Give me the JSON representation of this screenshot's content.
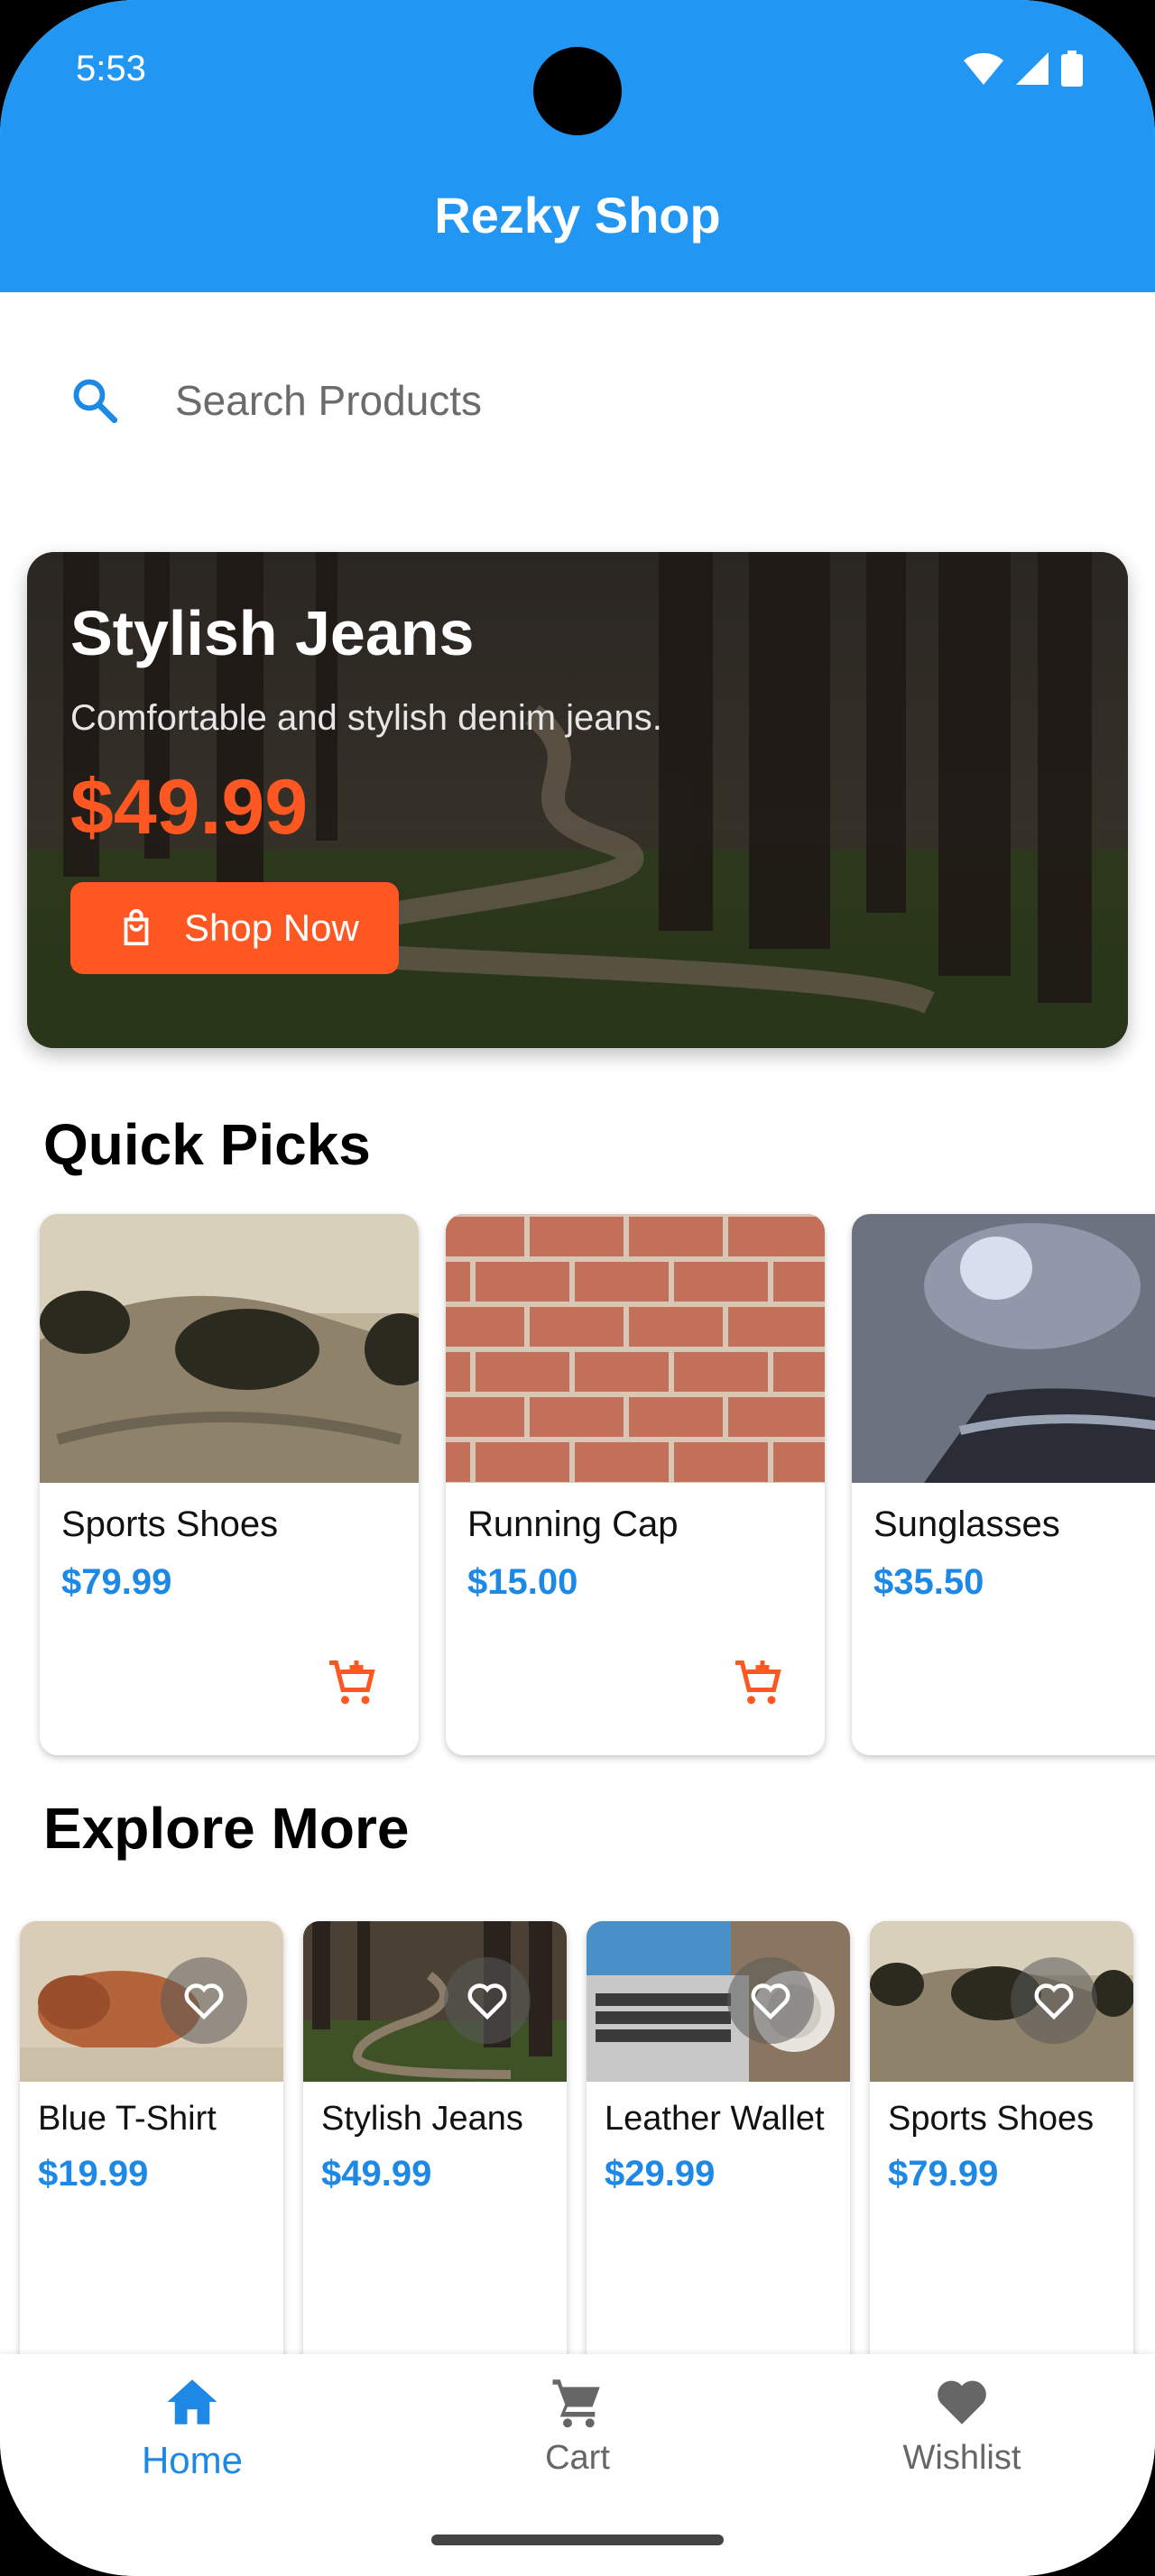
{
  "status_bar": {
    "time": "5:53"
  },
  "app_bar": {
    "title": "Rezky Shop"
  },
  "search": {
    "placeholder": "Search Products",
    "value": ""
  },
  "banner": {
    "title": "Stylish Jeans",
    "description": "Comfortable and stylish denim jeans.",
    "price": "$49.99",
    "button_label": "Shop Now"
  },
  "quick_picks": {
    "title": "Quick Picks",
    "items": [
      {
        "name": "Sports Shoes",
        "price": "$79.99"
      },
      {
        "name": "Running Cap",
        "price": "$15.00"
      },
      {
        "name": "Sunglasses",
        "price": "$35.50"
      }
    ]
  },
  "explore_more": {
    "title": "Explore More",
    "items": [
      {
        "name": "Blue T-Shirt",
        "price": "$19.99"
      },
      {
        "name": "Stylish Jeans",
        "price": "$49.99"
      },
      {
        "name": "Leather Wallet",
        "price": "$29.99"
      },
      {
        "name": "Sports Shoes",
        "price": "$79.99"
      }
    ]
  },
  "bottom_nav": {
    "items": [
      {
        "label": "Home",
        "icon": "home-icon",
        "active": true
      },
      {
        "label": "Cart",
        "icon": "cart-icon",
        "active": false
      },
      {
        "label": "Wishlist",
        "icon": "heart-icon",
        "active": false
      }
    ]
  },
  "colors": {
    "primary": "#2196F3",
    "accent": "#FF5722",
    "price": "#1E88E5"
  }
}
